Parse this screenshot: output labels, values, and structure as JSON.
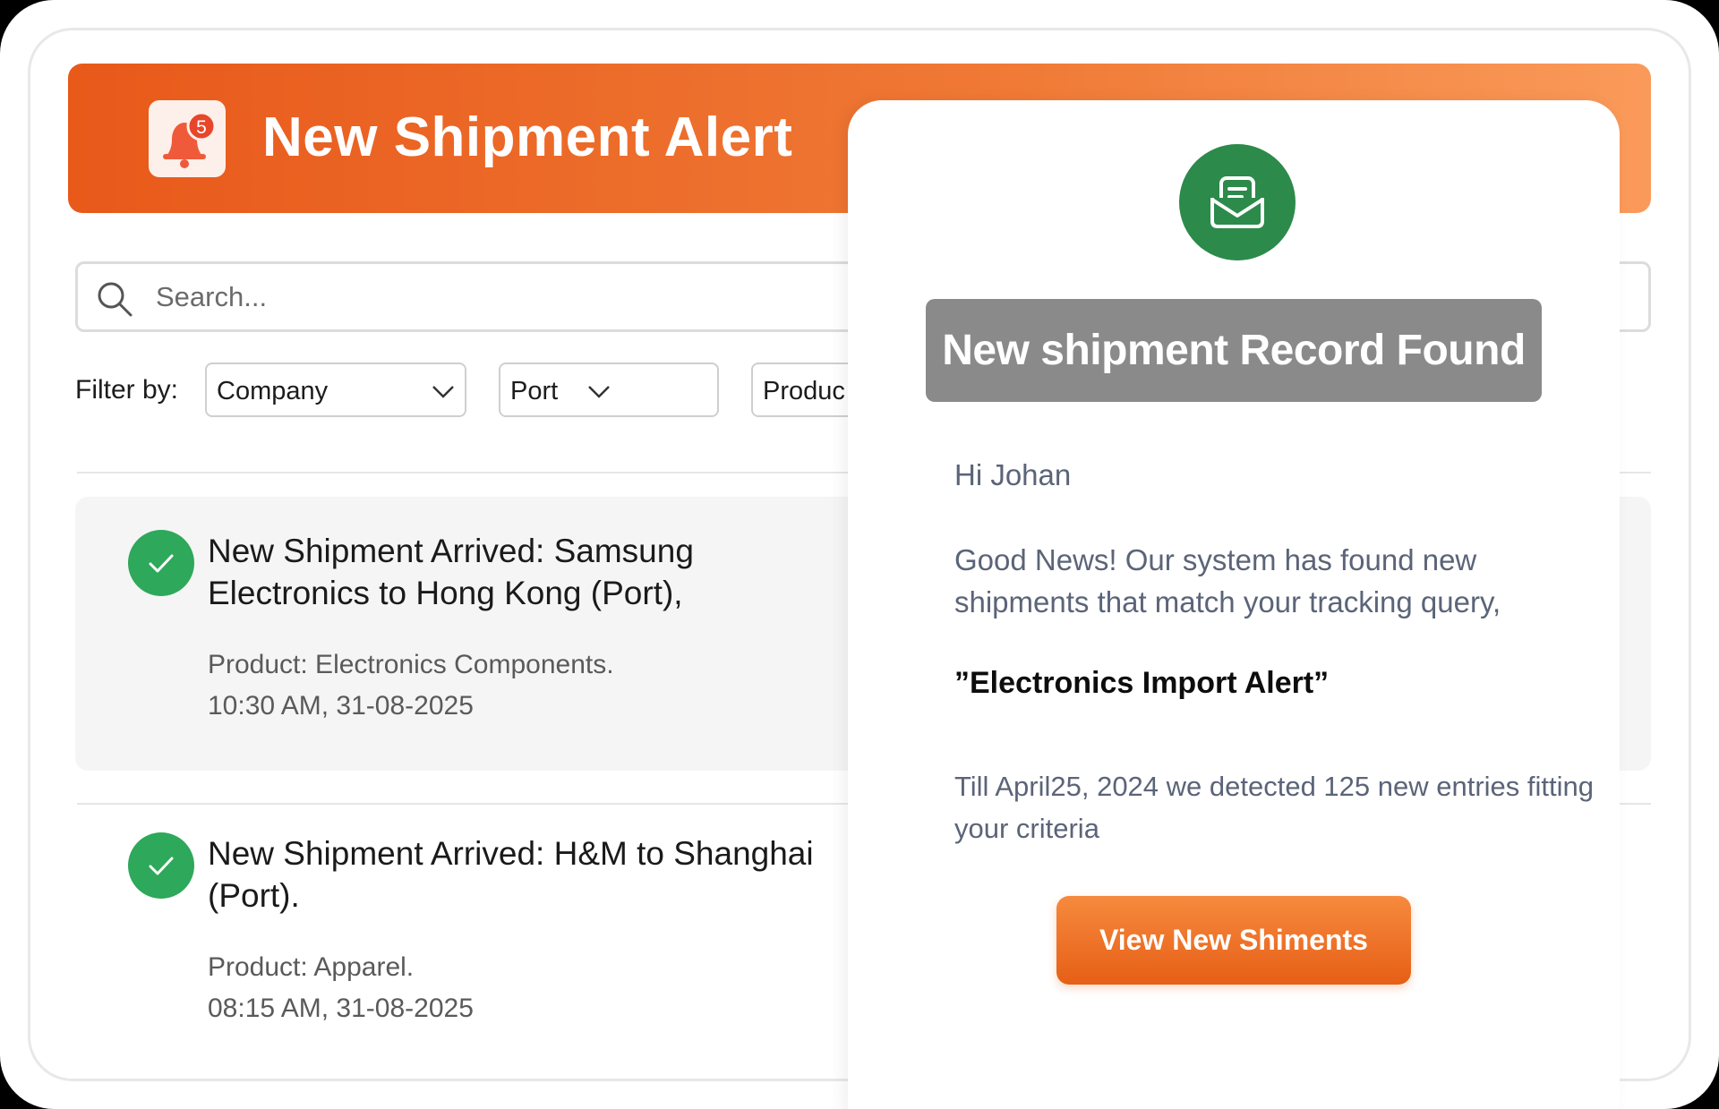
{
  "header": {
    "title": "New Shipment Alert",
    "notification_count": "5",
    "accent_color": "#e8591a"
  },
  "search": {
    "placeholder": "Search..."
  },
  "filters": {
    "label": "Filter by:",
    "company": "Company",
    "port": "Port",
    "product": "Produc"
  },
  "shipments": [
    {
      "title": "New Shipment Arrived: Samsung Electronics to Hong Kong (Port),",
      "product": "Product: Electronics Components.",
      "time": "10:30 AM, 31-08-2025",
      "status": "check-icon"
    },
    {
      "title": "New Shipment Arrived: H&M to Shanghai (Port).",
      "product": "Product: Apparel.",
      "time": "08:15 AM, 31-08-2025",
      "status": "check-icon"
    }
  ],
  "modal": {
    "heading": "New shipment Record Found",
    "greeting": "Hi Johan",
    "message": "Good News! Our system has found new shipments that match your tracking query,",
    "query_name": "”Electronics Import Alert”",
    "detected": "Till April25, 2024 we detected 125 new entries fitting your criteria",
    "button_label": "View New Shiments",
    "icon_color": "#2c8a4b"
  }
}
